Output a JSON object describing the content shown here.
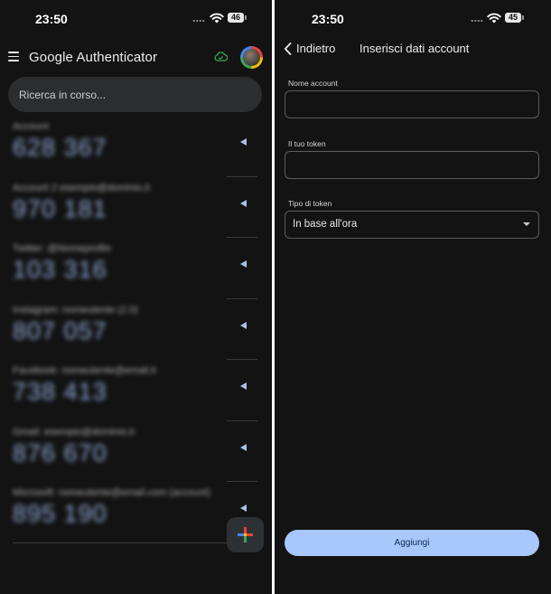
{
  "left": {
    "status": {
      "time": "23:50",
      "battery": "46"
    },
    "app_title": "Google Authenticator",
    "search": {
      "text": "Ricerca in corso..."
    },
    "accounts": [
      {
        "name": "Account",
        "code": "628 367"
      },
      {
        "name": "Account 2 esempio@dominio.it",
        "code": "970 181"
      },
      {
        "name": "Twitter: @Nomeprofilo",
        "code": "103 316"
      },
      {
        "name": "Instagram: nomeutente (2.0)",
        "code": "807 057"
      },
      {
        "name": "Facebook: nomeutente@email.it",
        "code": "738 413"
      },
      {
        "name": "Gmail: esempio@dominio.it",
        "code": "876 670"
      },
      {
        "name": "Microsoft: nomeutente@email.com (account)",
        "code": "895 190"
      }
    ],
    "icons": {
      "menu": "menu-icon",
      "cloud": "cloud-sync-icon",
      "timer": "countdown-timer-icon",
      "add": "plus-icon"
    },
    "colors": {
      "accent": "#a8c7fa",
      "cloud": "#34a853",
      "code": "#8fa9d6"
    }
  },
  "right": {
    "status": {
      "time": "23:50",
      "battery": "45"
    },
    "back_label": "Indietro",
    "title": "Inserisci dati account",
    "fields": {
      "account_name_label": "Nome account",
      "account_name_value": "",
      "token_label": "Il tuo token",
      "token_value": "",
      "token_type_label": "Tipo di token",
      "token_type_value": "In base all'ora"
    },
    "submit_label": "Aggiungi",
    "icons": {
      "back": "chevron-left-icon",
      "dropdown": "dropdown-arrow-icon"
    }
  }
}
